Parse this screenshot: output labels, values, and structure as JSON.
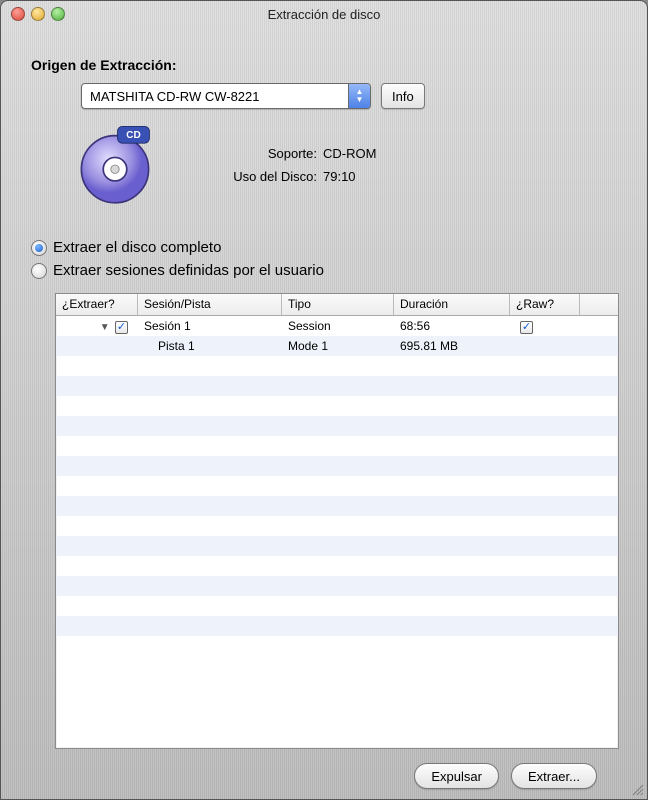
{
  "window": {
    "title": "Extracción de disco"
  },
  "source": {
    "label": "Origen de Extracción:",
    "device": "MATSHITA CD-RW CW-8221",
    "info_button": "Info"
  },
  "media": {
    "support_label": "Soporte:",
    "support_value": "CD-ROM",
    "usage_label": "Uso del Disco:",
    "usage_value": "79:10"
  },
  "options": {
    "full": "Extraer el disco completo",
    "user": "Extraer sesiones definidas por el usuario",
    "selected": "full"
  },
  "table": {
    "headers": {
      "extract": "¿Extraer?",
      "session": "Sesión/Pista",
      "type": "Tipo",
      "duration": "Duración",
      "raw": "¿Raw?"
    },
    "rows": [
      {
        "indent": 0,
        "disclosure": true,
        "extract_checked": true,
        "session": "Sesión 1",
        "type": "Session",
        "duration": "68:56",
        "raw_checked": true
      },
      {
        "indent": 1,
        "disclosure": false,
        "extract_checked": null,
        "session": "Pista 1",
        "type": "Mode 1",
        "duration": "695.81 MB",
        "raw_checked": null
      }
    ]
  },
  "buttons": {
    "eject": "Expulsar",
    "extract": "Extraer..."
  }
}
